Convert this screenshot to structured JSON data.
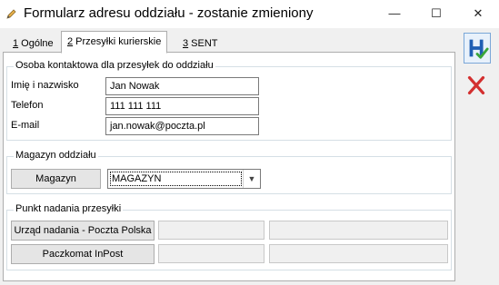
{
  "window": {
    "title": "Formularz adresu oddziału - zostanie zmieniony",
    "app_icon": "pencil-icon",
    "minimize_glyph": "—",
    "maximize_glyph": "☐",
    "close_glyph": "✕"
  },
  "tabs": [
    {
      "hotkey": "1",
      "label": " Ogólne",
      "active": false
    },
    {
      "hotkey": "2",
      "label": " Przesyłki kurierskie",
      "active": true
    },
    {
      "hotkey": "3",
      "label": " SENT",
      "active": false
    }
  ],
  "contact_group": {
    "title": "Osoba kontaktowa dla przesyłek do oddziału",
    "name_label": "Imię i nazwisko",
    "name_value": "Jan Nowak",
    "phone_label": "Telefon",
    "phone_value": "111 111 111",
    "email_label": "E-mail",
    "email_value": "jan.nowak@poczta.pl"
  },
  "warehouse_group": {
    "title": "Magazyn oddziału",
    "button_label": "Magazyn",
    "selected_value": "MAGAZYN",
    "arrow_icon": "chevron-down-icon"
  },
  "shipping_group": {
    "title": "Punkt nadania przesyłki",
    "post_office_button": "Urząd nadania - Poczta Polska",
    "post_office_code": "",
    "post_office_name": "",
    "paczkomat_button": "Paczkomat InPost",
    "paczkomat_code": "",
    "paczkomat_name": ""
  },
  "toolbar": {
    "save_icon": "save-check-icon",
    "cancel_icon": "cancel-x-icon",
    "accent_blue": "#1f5fb4",
    "accent_green": "#3aa63a",
    "accent_red": "#d32f2f"
  }
}
